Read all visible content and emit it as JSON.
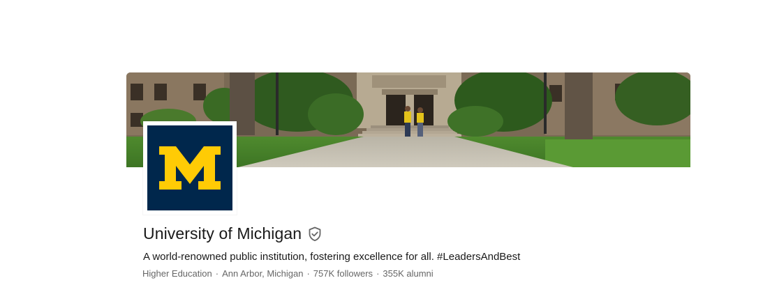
{
  "company": {
    "name": "University of Michigan",
    "tagline": "A world-renowned public institution, fostering excellence for all. #LeadersAndBest",
    "industry": "Higher Education",
    "location": "Ann Arbor, Michigan",
    "followers": "757K followers",
    "alumni": "355K alumni",
    "separator": "·",
    "logo_letter": "M"
  },
  "colors": {
    "logo_background": "#00274c",
    "logo_letter": "#ffcb05",
    "text_primary": "#191919",
    "text_secondary": "#666666"
  },
  "icons": {
    "verified": "shield-check-icon"
  }
}
